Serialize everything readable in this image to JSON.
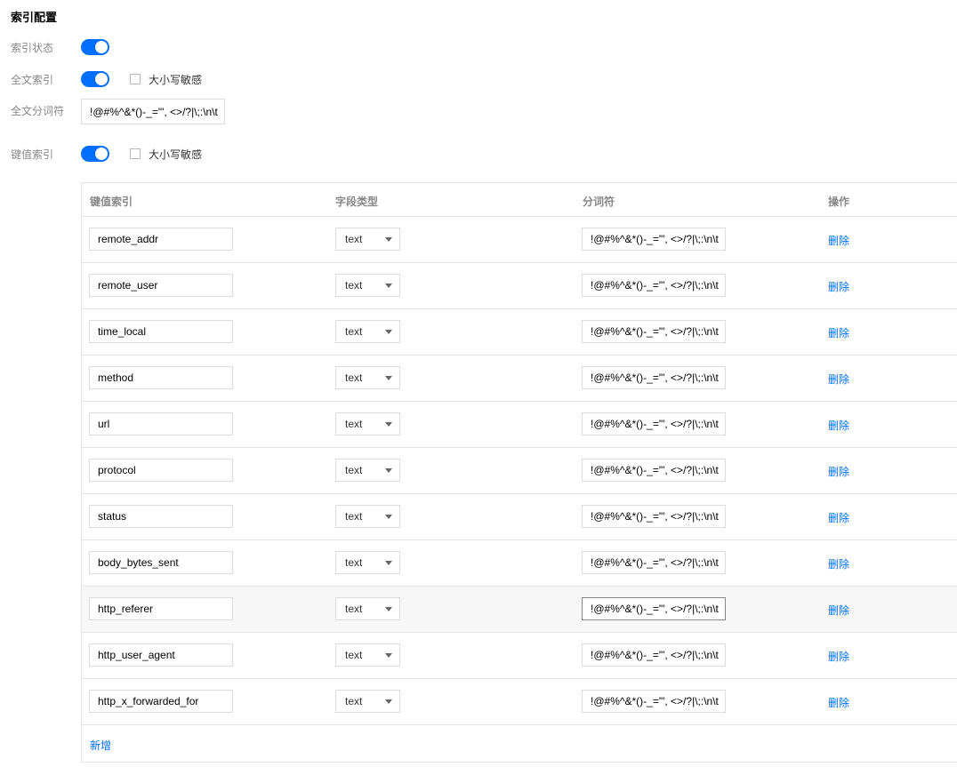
{
  "section_title": "索引配置",
  "index_status": {
    "label": "索引状态",
    "on": true
  },
  "fulltext_index": {
    "label": "全文索引",
    "on": true,
    "case_sensitive_label": "大小写敏感",
    "case_sensitive": false
  },
  "fulltext_tokenizer": {
    "label": "全文分词符",
    "value": "!@#%^&*()-_=\"', <>/?|\\;:\\n\\t"
  },
  "key_index": {
    "label": "键值索引",
    "on": true,
    "case_sensitive_label": "大小写敏感",
    "case_sensitive": false
  },
  "table": {
    "headers": {
      "key": "键值索引",
      "type": "字段类型",
      "tokenizer": "分词符",
      "action": "操作"
    },
    "rows": [
      {
        "key": "remote_addr",
        "type": "text",
        "tokenizer": "!@#%^&*()-_=\"', <>/?|\\;:\\n\\t",
        "action": "删除"
      },
      {
        "key": "remote_user",
        "type": "text",
        "tokenizer": "!@#%^&*()-_=\"', <>/?|\\;:\\n\\t",
        "action": "删除"
      },
      {
        "key": "time_local",
        "type": "text",
        "tokenizer": "!@#%^&*()-_=\"', <>/?|\\;:\\n\\t",
        "action": "删除"
      },
      {
        "key": "method",
        "type": "text",
        "tokenizer": "!@#%^&*()-_=\"', <>/?|\\;:\\n\\t",
        "action": "删除"
      },
      {
        "key": "url",
        "type": "text",
        "tokenizer": "!@#%^&*()-_=\"', <>/?|\\;:\\n\\t",
        "action": "删除"
      },
      {
        "key": "protocol",
        "type": "text",
        "tokenizer": "!@#%^&*()-_=\"', <>/?|\\;:\\n\\t",
        "action": "删除"
      },
      {
        "key": "status",
        "type": "text",
        "tokenizer": "!@#%^&*()-_=\"', <>/?|\\;:\\n\\t",
        "action": "删除"
      },
      {
        "key": "body_bytes_sent",
        "type": "text",
        "tokenizer": "!@#%^&*()-_=\"', <>/?|\\;:\\n\\t",
        "action": "删除"
      },
      {
        "key": "http_referer",
        "type": "text",
        "tokenizer": "!@#%^&*()-_=\"', <>/?|\\;:\\n\\t",
        "action": "删除"
      },
      {
        "key": "http_user_agent",
        "type": "text",
        "tokenizer": "!@#%^&*()-_=\"', <>/?|\\;:\\n\\t",
        "action": "删除"
      },
      {
        "key": "http_x_forwarded_for",
        "type": "text",
        "tokenizer": "!@#%^&*()-_=\"', <>/?|\\;:\\n\\t",
        "action": "删除"
      }
    ],
    "add_label": "新增"
  },
  "colors": {
    "accent": "#006eff",
    "label": "#888888",
    "border": "#dddddd"
  }
}
